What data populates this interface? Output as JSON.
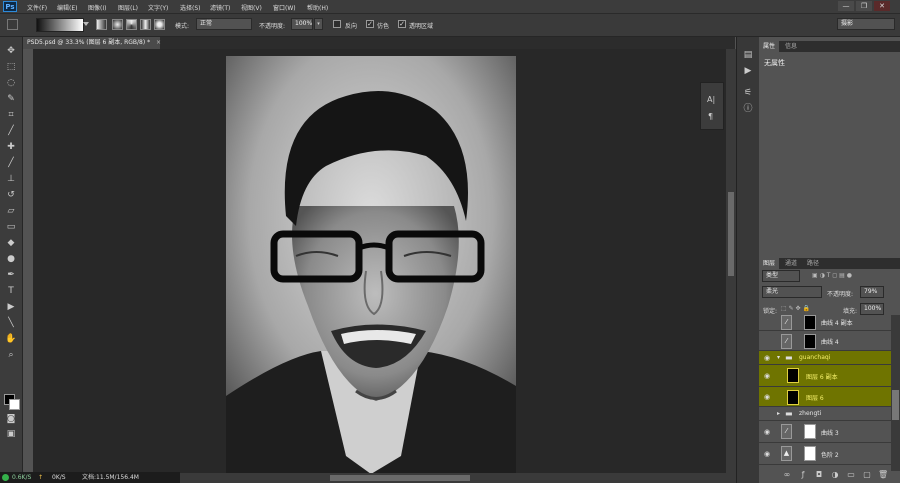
{
  "app": {
    "logo": "Ps"
  },
  "menu": [
    "文件(F)",
    "编辑(E)",
    "图像(I)",
    "图层(L)",
    "文字(Y)",
    "选择(S)",
    "滤镜(T)",
    "视图(V)",
    "窗口(W)",
    "帮助(H)"
  ],
  "window_controls": [
    "—",
    "❐",
    "✕"
  ],
  "options": {
    "mode_label": "模式:",
    "mode_value": "正常",
    "opacity_label": "不透明度:",
    "opacity_value": "100%",
    "reverse_label": "反向",
    "dither_label": "仿色",
    "transparency_label": "透明区域",
    "workspace_value": "摄影"
  },
  "document": {
    "tab_title": "PSD5.psd @ 33.3% (图层 6 副本, RGB/8) *",
    "close": "×"
  },
  "status": {
    "upload": "0.6K/S",
    "download": "0K/S",
    "doc_info": "文档:11.5M/156.4M"
  },
  "mini_palette": [
    "A|",
    "¶"
  ],
  "properties": {
    "tabs": [
      "属性",
      "信息"
    ],
    "content": "无属性"
  },
  "layers_panel": {
    "tabs": [
      "图层",
      "通道",
      "路径"
    ],
    "filter_kind": "类型",
    "blend_mode": "柔光",
    "opacity_label": "不透明度:",
    "opacity_value": "79%",
    "lock_label": "锁定:",
    "fill_label": "填充:",
    "fill_value": "100%",
    "layers": [
      {
        "name": "曲线 4 副本",
        "visible": false,
        "selected": false,
        "kind": "adjustment"
      },
      {
        "name": "曲线 4",
        "visible": false,
        "selected": false,
        "kind": "adjustment"
      },
      {
        "name": "guanchaqi",
        "visible": true,
        "selected": true,
        "kind": "group-open"
      },
      {
        "name": "图层 6 副本",
        "visible": true,
        "selected": true,
        "kind": "pixel"
      },
      {
        "name": "图层 6",
        "visible": true,
        "selected": true,
        "kind": "pixel"
      },
      {
        "name": "zhengti",
        "visible": false,
        "selected": false,
        "kind": "group-closed"
      },
      {
        "name": "曲线 3",
        "visible": true,
        "selected": false,
        "kind": "adjustment"
      },
      {
        "name": "色阶 2",
        "visible": true,
        "selected": false,
        "kind": "levels"
      }
    ]
  },
  "colors": {
    "selection": "#6f7400",
    "selection_text": "#f5f06a",
    "accent": "#2d8ad9"
  }
}
